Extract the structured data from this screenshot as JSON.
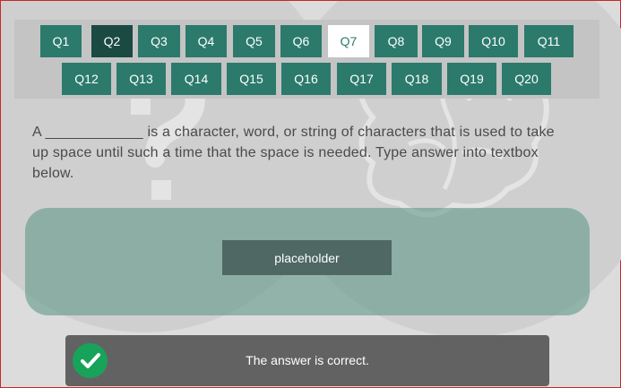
{
  "questions": [
    "Q1",
    "Q2",
    "Q3",
    "Q4",
    "Q5",
    "Q6",
    "Q7",
    "Q8",
    "Q9",
    "Q10",
    "Q11",
    "Q12",
    "Q13",
    "Q14",
    "Q15",
    "Q16",
    "Q17",
    "Q18",
    "Q19",
    "Q20"
  ],
  "completed_question": "Q2",
  "current_question": "Q7",
  "question_text": "A ____________ is a character, word, or string of characters that is used to take up space until such a time that the space is needed. Type answer into textbox below.",
  "answer_field": {
    "value": "placeholder"
  },
  "feedback": {
    "text": "The answer is correct.",
    "icon": "check-icon",
    "status": "correct"
  },
  "colors": {
    "accent": "#2b7a6c",
    "completed": "#1a4a42",
    "current": "#ffffff",
    "success": "#17a35a",
    "feedback_bg": "#626262"
  }
}
